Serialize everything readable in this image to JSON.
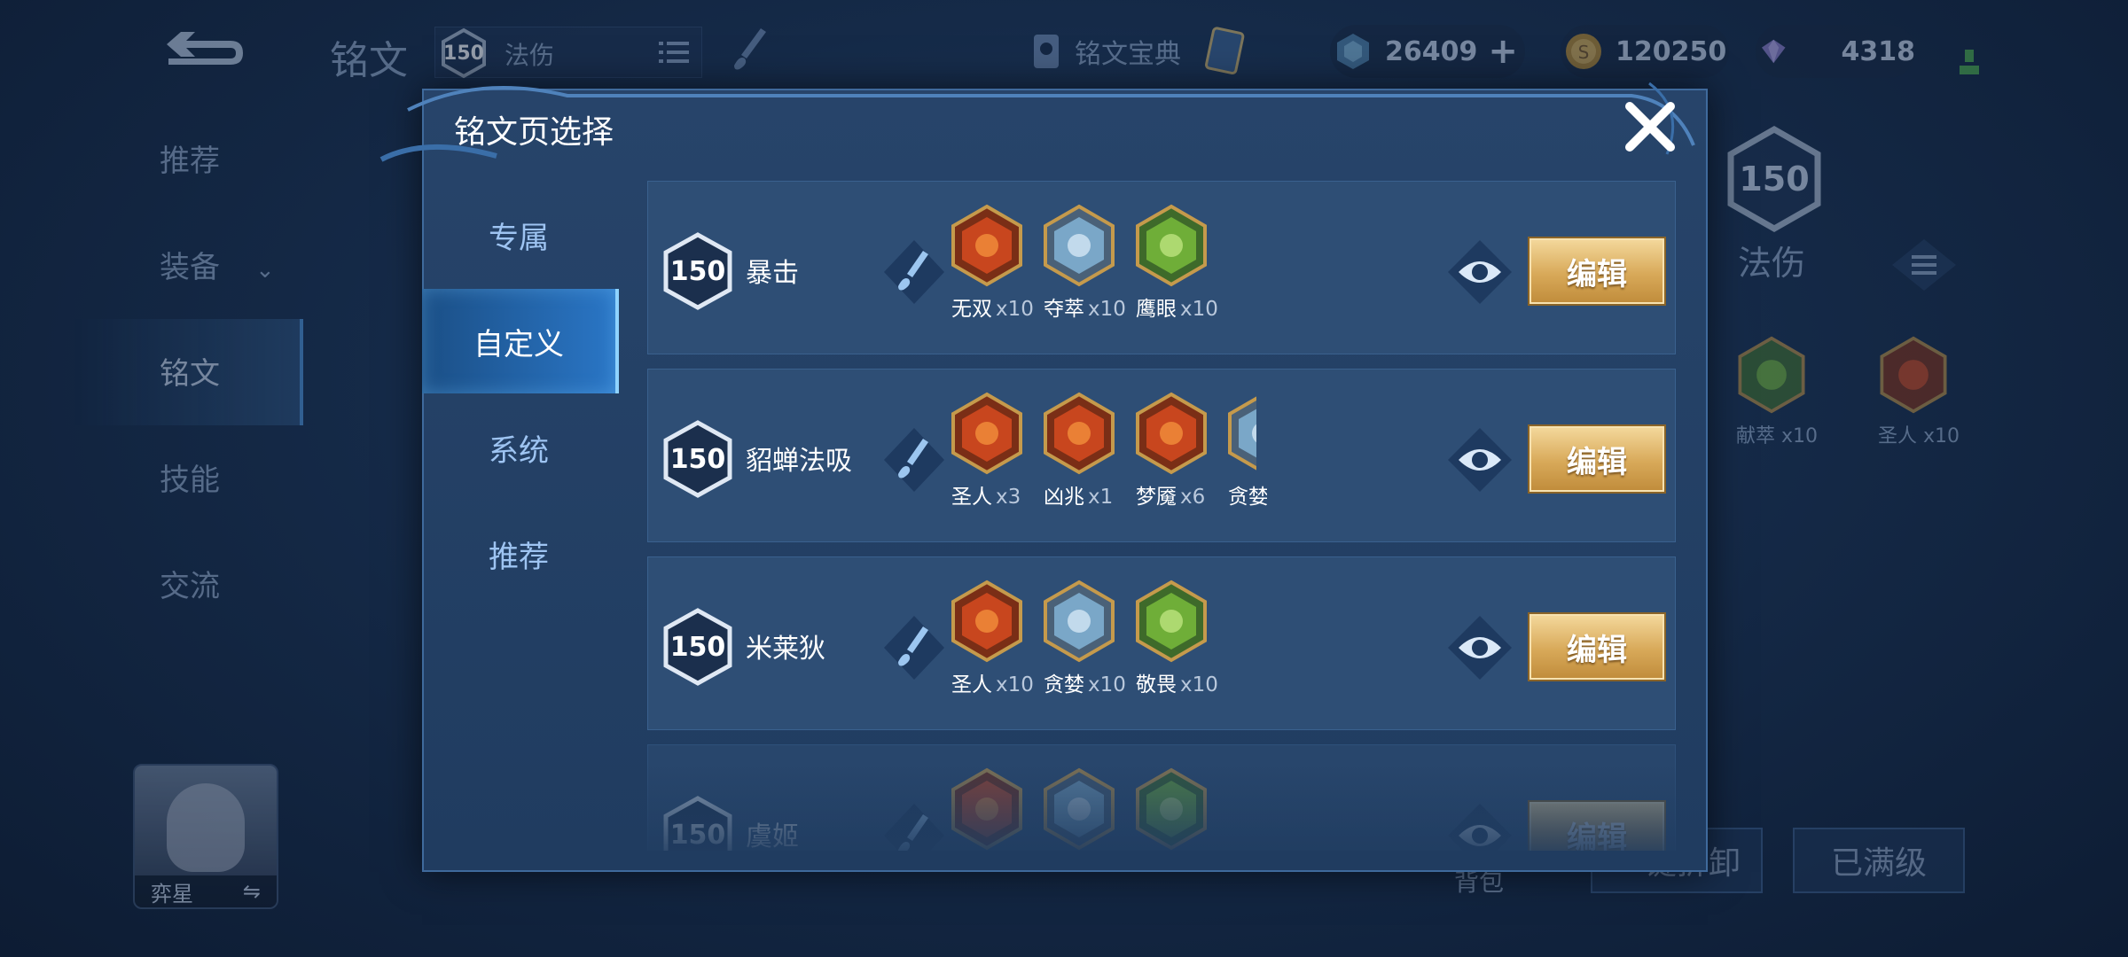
{
  "background": {
    "title": "铭文",
    "level": "150",
    "select_label": "法伤",
    "codex_label": "铭文宝典",
    "currency": [
      {
        "icon": "gem-hex-icon",
        "value": "26409"
      },
      {
        "icon": "gold-coin-icon",
        "value": "120250"
      },
      {
        "icon": "diamond-icon",
        "value": "4318"
      }
    ],
    "nav": [
      "推荐",
      "装备",
      "铭文",
      "技能",
      "交流"
    ],
    "right_panel": {
      "level": "150",
      "label": "法伤",
      "runes": [
        {
          "name": "献萃",
          "count": "x10"
        },
        {
          "name": "圣人",
          "count": "x10"
        }
      ]
    },
    "hero_name": "弈星",
    "bag_label": "背包",
    "unload_label": "一键拆卸",
    "maxed_label": "已满级"
  },
  "modal": {
    "title": "铭文页选择",
    "tabs": [
      "专属",
      "自定义",
      "系统",
      "推荐"
    ],
    "active_tab": "自定义",
    "edit_label": "编辑",
    "pages": [
      {
        "level": "150",
        "name": "暴击",
        "runes": [
          {
            "name": "无双",
            "count": "x10",
            "color": "red"
          },
          {
            "name": "夺萃",
            "count": "x10",
            "color": "blue"
          },
          {
            "name": "鹰眼",
            "count": "x10",
            "color": "green"
          }
        ]
      },
      {
        "level": "150",
        "name": "貂蝉法吸",
        "runes": [
          {
            "name": "圣人",
            "count": "x3",
            "color": "red"
          },
          {
            "name": "凶兆",
            "count": "x1",
            "color": "red"
          },
          {
            "name": "梦魇",
            "count": "x6",
            "color": "red"
          },
          {
            "name": "贪婪",
            "count": "",
            "color": "blue"
          }
        ]
      },
      {
        "level": "150",
        "name": "米莱狄",
        "runes": [
          {
            "name": "圣人",
            "count": "x10",
            "color": "red"
          },
          {
            "name": "贪婪",
            "count": "x10",
            "color": "blue"
          },
          {
            "name": "敬畏",
            "count": "x10",
            "color": "green"
          }
        ]
      },
      {
        "level": "150",
        "name": "虞姬",
        "runes": [
          {
            "name": "",
            "count": "",
            "color": "red"
          },
          {
            "name": "",
            "count": "",
            "color": "blue"
          },
          {
            "name": "",
            "count": "",
            "color": "green"
          }
        ]
      }
    ]
  },
  "colors": {
    "accent": "#2a76c6",
    "gold_button": "#d8a959",
    "rune_red": "#c8461e",
    "rune_blue": "#7aa7c8",
    "rune_green": "#6fae38"
  }
}
